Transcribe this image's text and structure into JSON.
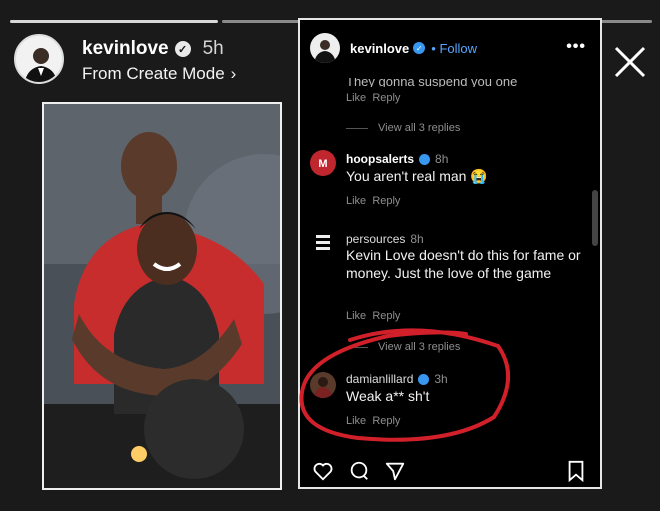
{
  "story": {
    "username": "kevinlove",
    "time": "5h",
    "subtitle": "From Create Mode",
    "progress": [
      1.0,
      0.0
    ]
  },
  "post": {
    "username": "kevinlove",
    "follow_label": "Follow",
    "cut_text": "They gonna suspend you one",
    "comments": [
      {
        "links": [
          "Like",
          "Reply"
        ],
        "view_replies": "View all 3 replies"
      },
      {
        "user": "hoopsalerts",
        "time": "8h",
        "text": "You aren't real man 😭",
        "links": [
          "Like",
          "Reply"
        ]
      },
      {
        "user": "persources",
        "time": "8h",
        "text": "Kevin Love doesn't do this for fame or money. Just the love of the game",
        "links": [
          "Like",
          "Reply"
        ],
        "view_replies": "View all 3 replies"
      },
      {
        "user": "damianlillard",
        "time": "3h",
        "text": "Weak a** sh't",
        "links": [
          "Like",
          "Reply"
        ]
      }
    ]
  },
  "colors": {
    "accent_blue": "#3897f0",
    "circle_red": "#d2202a"
  }
}
